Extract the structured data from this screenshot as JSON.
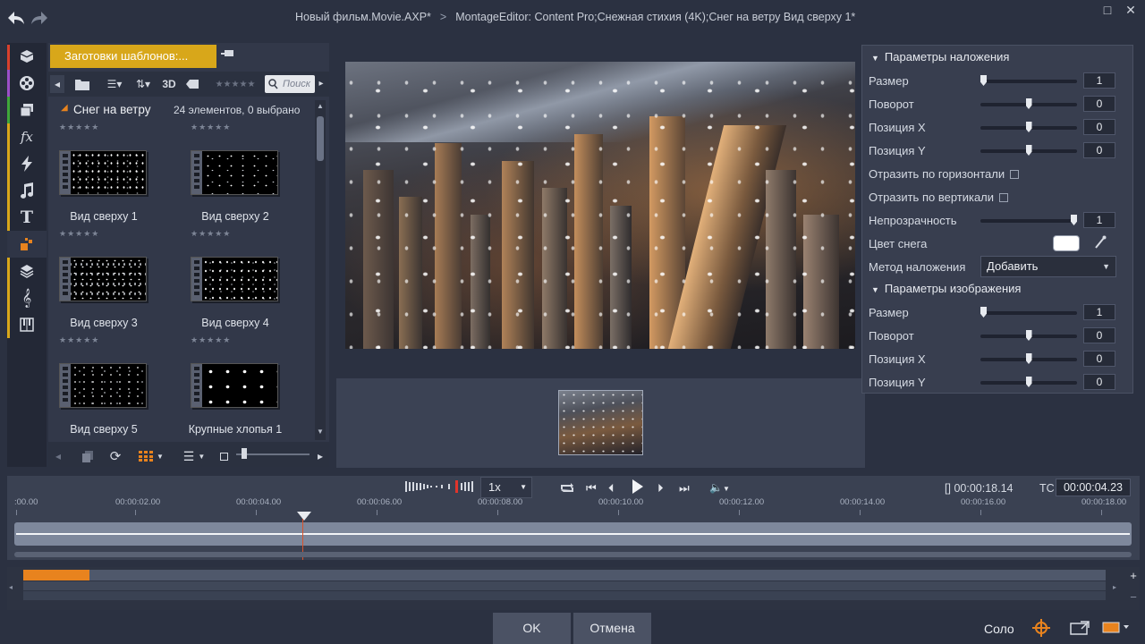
{
  "header": {
    "breadcrumb_project": "Новый фильм.Movie.AXP*",
    "breadcrumb_separator": ">",
    "breadcrumb_editor": "MontageEditor: Content Pro;Снежная стихия (4K);Снег на ветру  Вид сверху 1*",
    "maximize": "□",
    "close": "✕"
  },
  "library": {
    "tab_label": "Заготовки шаблонов:...",
    "view_3d": "3D",
    "search_placeholder": "Поиск",
    "rating": "★★★★★",
    "folder_name": "Снег на ветру",
    "folder_count": "24 элементов, 0 выбрано",
    "items": [
      {
        "label": "Вид сверху 1",
        "rating": "★★★★★"
      },
      {
        "label": "Вид сверху 2",
        "rating": "★★★★★"
      },
      {
        "label": "Вид сверху 3",
        "rating": "★★★★★"
      },
      {
        "label": "Вид сверху 4",
        "rating": "★★★★★"
      },
      {
        "label": "Вид сверху 5",
        "rating": "★★★★★"
      },
      {
        "label": "Крупные хлопья 1",
        "rating": "★★★★★"
      }
    ],
    "top_rating": "★★★★★"
  },
  "params": {
    "overlay_header": "Параметры наложения",
    "overlay": {
      "size_label": "Размер",
      "size_value": "1",
      "size_level": 0.0,
      "rotation_label": "Поворот",
      "rotation_value": "0",
      "rotation_level": 0.5,
      "pos_x_label": "Позиция X",
      "pos_x_value": "0",
      "pos_x_level": 0.5,
      "pos_y_label": "Позиция Y",
      "pos_y_value": "0",
      "pos_y_level": 0.5,
      "flip_h_label": "Отразить по горизонтали",
      "flip_v_label": "Отразить по вертикали",
      "opacity_label": "Непрозрачность",
      "opacity_value": "1",
      "opacity_level": 1.0,
      "snow_color_label": "Цвет снега",
      "snow_color": "#ffffff",
      "blend_label": "Метод наложения",
      "blend_value": "Добавить"
    },
    "image_header": "Параметры изображения",
    "image": {
      "size_label": "Размер",
      "size_value": "1",
      "size_level": 0.0,
      "rotation_label": "Поворот",
      "rotation_value": "0",
      "rotation_level": 0.5,
      "pos_x_label": "Позиция X",
      "pos_x_value": "0",
      "pos_x_level": 0.5,
      "pos_y_label": "Позиция Y",
      "pos_y_value": "0",
      "pos_y_level": 0.5
    }
  },
  "transport": {
    "speed": "1x",
    "duration_prefix": "[]",
    "duration": "00:00:18.14",
    "tc_label": "TC",
    "timecode": "00:00:04.23",
    "ruler": ":00.00|00:00:02.00|00:00:04.00|00:00:06.00|00:00:08.00|00:00:10.00|00:00:12.00|00:00:14.00|00:00:16.00|00:00:18.00"
  },
  "footer": {
    "ok": "OK",
    "cancel": "Отмена",
    "solo": "Соло",
    "plus": "+",
    "minus": "−"
  },
  "colors": {
    "accent": "#d8a71a",
    "orange": "#e8831e",
    "background": "#2b3141"
  }
}
